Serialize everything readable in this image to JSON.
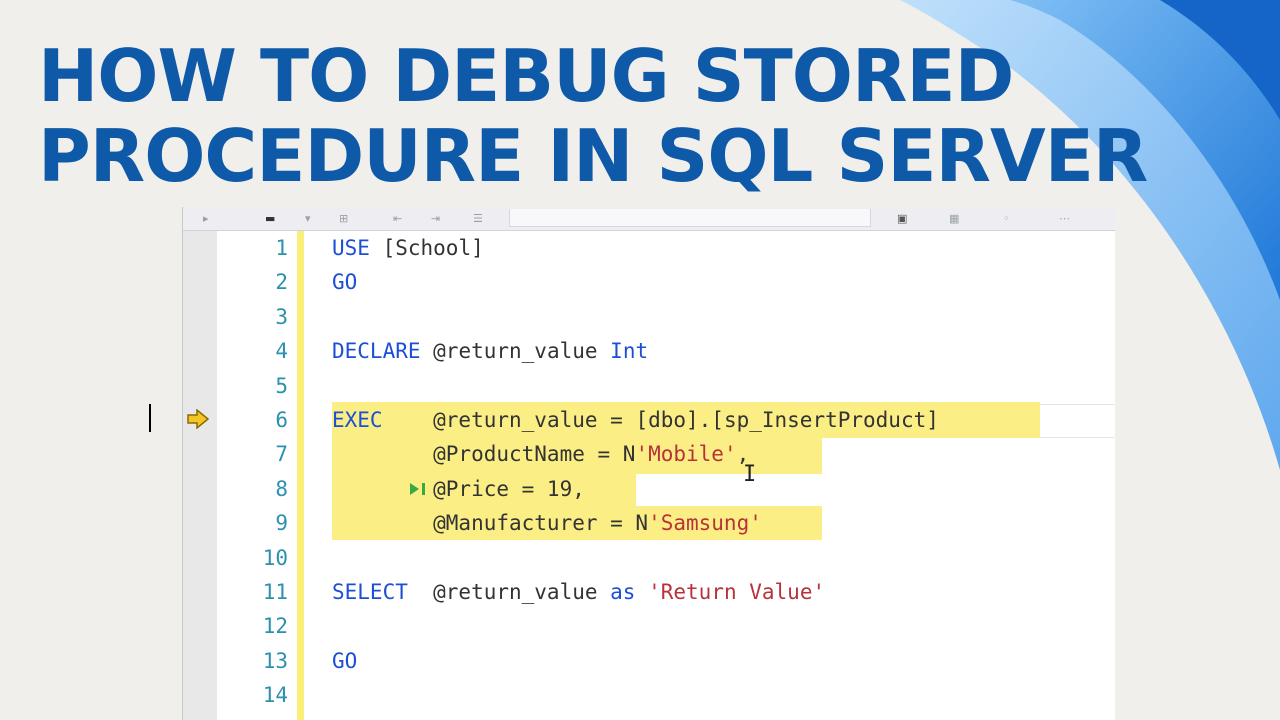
{
  "title": {
    "line1": "HOW TO DEBUG STORED",
    "line2": "PROCEDURE IN SQL SERVER"
  },
  "colors": {
    "title": "#0f5aa8",
    "keyword": "#1c4fd6",
    "string": "#b8323a",
    "line_number": "#2b91af",
    "highlight": "#fbee85",
    "background": "#f1efec"
  },
  "editor": {
    "lines": [
      {
        "n": "1",
        "parts": [
          {
            "t": "USE",
            "c": "kw"
          },
          {
            "t": " [School]",
            "c": "id"
          }
        ]
      },
      {
        "n": "2",
        "parts": [
          {
            "t": "GO",
            "c": "kw"
          }
        ]
      },
      {
        "n": "3",
        "parts": []
      },
      {
        "n": "4",
        "parts": [
          {
            "t": "DECLARE",
            "c": "kw"
          },
          {
            "t": " @return_value ",
            "c": "id"
          },
          {
            "t": "Int",
            "c": "kw"
          }
        ]
      },
      {
        "n": "5",
        "parts": []
      },
      {
        "n": "6",
        "parts": [
          {
            "t": "EXEC",
            "c": "kw"
          },
          {
            "t": "    @return_value = [dbo].[sp_InsertProduct]",
            "c": "id"
          }
        ]
      },
      {
        "n": "7",
        "parts": [
          {
            "t": "        @ProductName = N",
            "c": "id"
          },
          {
            "t": "'Mobile'",
            "c": "str"
          },
          {
            "t": ",",
            "c": "id"
          }
        ]
      },
      {
        "n": "8",
        "parts": [
          {
            "t": "        @Price = 19,",
            "c": "id"
          }
        ]
      },
      {
        "n": "9",
        "parts": [
          {
            "t": "        @Manufacturer = N",
            "c": "id"
          },
          {
            "t": "'Samsung'",
            "c": "str"
          }
        ]
      },
      {
        "n": "10",
        "parts": []
      },
      {
        "n": "11",
        "parts": [
          {
            "t": "SELECT",
            "c": "kw"
          },
          {
            "t": "  @return_value ",
            "c": "id"
          },
          {
            "t": "as",
            "c": "kw"
          },
          {
            "t": " ",
            "c": "id"
          },
          {
            "t": "'Return Value'",
            "c": "str"
          }
        ]
      },
      {
        "n": "12",
        "parts": []
      },
      {
        "n": "13",
        "parts": [
          {
            "t": "GO",
            "c": "kw"
          }
        ]
      },
      {
        "n": "14",
        "parts": []
      }
    ],
    "current_statement_icon": "yellow-arrow-icon",
    "step_marker_icon": "run-to-cursor-icon",
    "cursor_icon": "text-ibeam-icon"
  }
}
